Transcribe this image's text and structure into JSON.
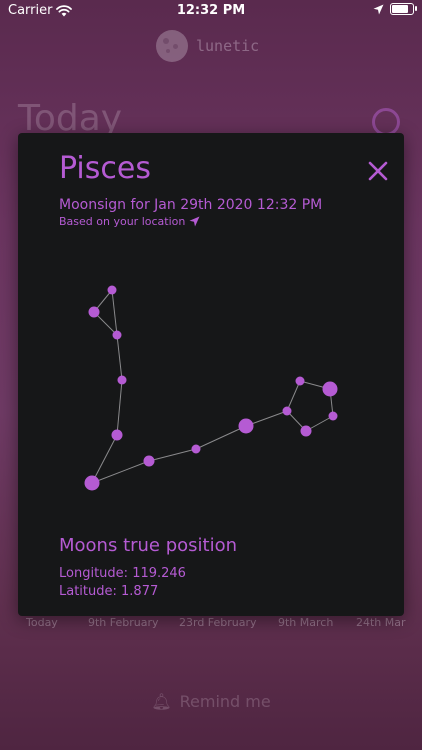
{
  "status_bar": {
    "carrier": "Carrier",
    "time": "12:32 PM",
    "battery_level": 0.9
  },
  "app": {
    "name": "lunetic",
    "background_title": "Today"
  },
  "dates": [
    "Today",
    "9th February",
    "23rd February",
    "9th March",
    "24th Mar"
  ],
  "remind": {
    "label": "Remind me",
    "icon": "bell-icon"
  },
  "modal": {
    "sign": "Pisces",
    "subtitle": "Moonsign for Jan 29th 2020 12:32 PM",
    "location_note": "Based on your location",
    "location_icon": "location-arrow-icon",
    "close_icon": "close-icon",
    "position_title": "Moons true position",
    "longitude_label": "Longitude:",
    "longitude_value": "119.246",
    "latitude_label": "Latitude:",
    "latitude_value": "1.877",
    "accent_color": "#b55bd3",
    "line_color": "#8a8a8c"
  }
}
